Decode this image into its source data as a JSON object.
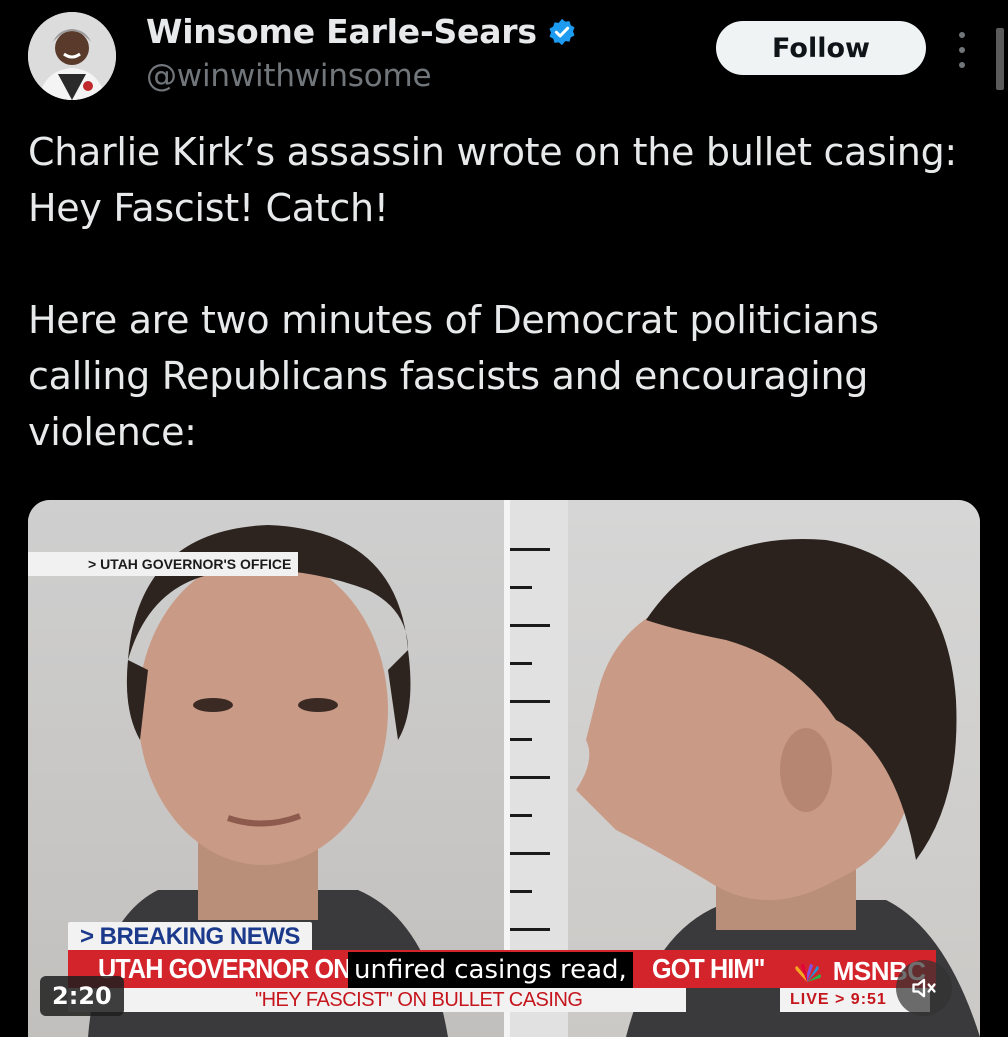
{
  "author": {
    "name": "Winsome Earle-Sears",
    "handle": "@winwithwinsome",
    "verified": true,
    "verified_color": "#1d9bf0"
  },
  "actions": {
    "follow_label": "Follow",
    "more_icon": "more-vertical-icon"
  },
  "tweet": {
    "paragraph1": "Charlie Kirk’s assassin wrote on the bullet casing: Hey Fascist! Catch!",
    "paragraph2": "Here are two minutes of Democrat politicians calling Republicans fascists and encouraging violence:"
  },
  "video": {
    "source_label": "> UTAH GOVERNOR'S OFFICE",
    "breaking_label": "> BREAKING NEWS",
    "headline": "UTAH GOVERNOR ON KIR",
    "headline_tail": "GOT HIM\"",
    "subheadline": "\"HEY FASCIST\" ON BULLET CASING",
    "caption": "unfired casings read,",
    "network": "MSNBC",
    "live_label": "LIVE > 9:51",
    "duration": "2:20",
    "chyron_color": "#d4242b",
    "mute_icon": "speaker-muted-icon"
  }
}
